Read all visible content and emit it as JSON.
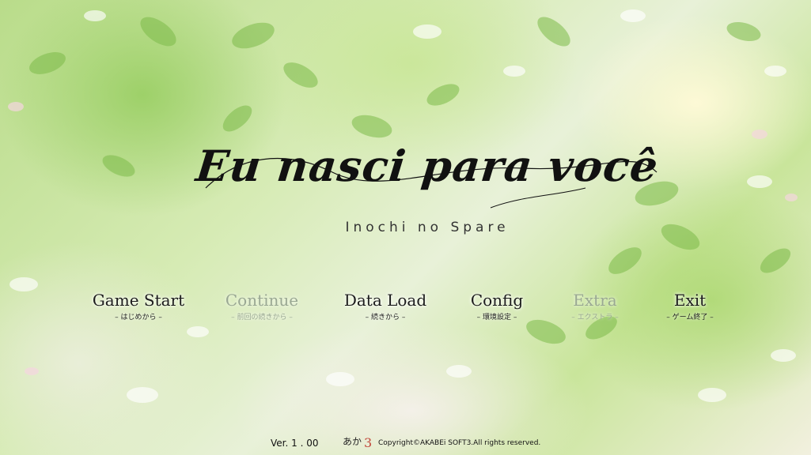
{
  "title": {
    "main": "Eu nasci para você",
    "subtitle": "Inochi no Spare"
  },
  "menu": {
    "items": [
      {
        "label": "Game Start",
        "sub": "– はじめから –",
        "enabled": true
      },
      {
        "label": "Continue",
        "sub": "– 前回の続きから –",
        "enabled": false
      },
      {
        "label": "Data Load",
        "sub": "– 続きから –",
        "enabled": true
      },
      {
        "label": "Config",
        "sub": "– 環境設定 –",
        "enabled": true
      },
      {
        "label": "Extra",
        "sub": "– エクストラ –",
        "enabled": false
      },
      {
        "label": "Exit",
        "sub": "– ゲーム終了 –",
        "enabled": true
      }
    ]
  },
  "footer": {
    "version": "Ver. 1 . 00",
    "copyright": "Copyright©AKABEi SOFT3.All rights reserved."
  },
  "colors": {
    "accent_leaf": "#8cc45a",
    "text_dark": "#1c1c1c",
    "disabled": "#9aa893"
  }
}
